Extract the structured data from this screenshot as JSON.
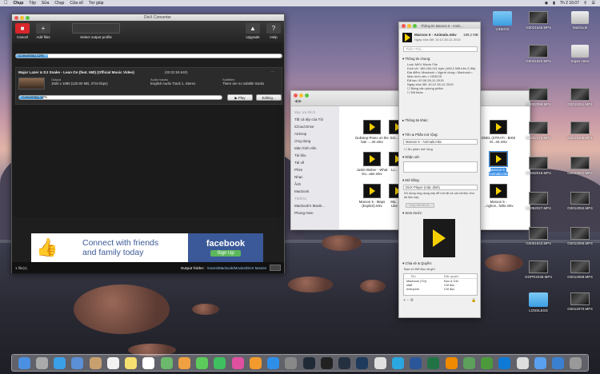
{
  "menubar": {
    "apple": "",
    "app": "Chụp",
    "items": [
      "Tệp",
      "Sửa",
      "Chụp",
      "Cửa sổ",
      "Trợ giúp"
    ],
    "status": "Th 2 16:07"
  },
  "divx": {
    "window_title": "DivX Converter",
    "cancel_label": "Cancel",
    "add_files_label": "Add files",
    "select_profile_label": "Select output profile",
    "upgrade_label": "Upgrade",
    "help_label": "Help",
    "overall_status": "Converting 12%",
    "overall_progress": 0.12,
    "job_title": "Major Lazer & DJ Snake - Lean On (feat. MØ) (Official Music Video)",
    "job_duration": "(00:02:58.840)",
    "output_label": "Output",
    "output_detail": "1920 x 1080 (120.00 MB, 3734 kbps)",
    "audio_label": "Audio tracks",
    "audio_detail": "English Audio Track 1, Stereo",
    "subtitle_label": "Subtitles",
    "subtitle_detail": "There are no subtitle tracks",
    "job_status": "Converting 12%",
    "job_progress": 0.12,
    "play_label": "Play",
    "editing_label": "Editing...",
    "ad_text_line1": "Connect with friends",
    "ad_text_line2": "and family today",
    "ad_brand": "facebook",
    "ad_cta": "Sign Up",
    "file_count": "1 file(s)",
    "output_folder_label": "Output folder:",
    "output_folder_path": "/Users/Macbook/Movies/DivX Movies"
  },
  "finder": {
    "sidebar_heading": "Mục ưa thích",
    "sidebar_items": [
      "Tất cả tệp của Tôi",
      "iCloud Drive",
      "AirDrop",
      "Ứng dụng",
      "Màn hình nền",
      "Tài liệu",
      "Tải về",
      "Phim",
      "Nhạc",
      "Ảnh",
      "Macbook"
    ],
    "devices_heading": "Thiết bị",
    "device_items": [
      "Macbook's MacB...",
      "Phong Hien"
    ],
    "files": [
      {
        "name": "Dubstep-Piano on the late -...4K.mkv"
      },
      {
        "name": "Em..."
      },
      {
        "name": "Justin Bieber - What Do...ater.mkv"
      },
      {
        "name": "Lo..."
      },
      {
        "name": "Maroon 5 - Maps (Explicit).mkv"
      },
      {
        "name": "Ma... Like"
      },
      {
        "name": "ONEL (STRATI - BIKE M...4K.mkv"
      },
      {
        "name": "Maroon 5 - Animals.mkv"
      },
      {
        "name": "Maroon 5 - ...nghon...hslts.mkv"
      }
    ]
  },
  "info": {
    "window_title": "Thông tin Maroon 5 - Anim...",
    "file_name": "Maroon 5 - Animals.mkv",
    "file_size": "189,2 MB",
    "modified": "Ngày sửa đổi: 10:12 28-12-2015",
    "tags_placeholder": "Thêm Thẻ...",
    "general_heading": "Thông tin chung:",
    "general_rows": [
      "Loại: MKV Movie File",
      "Kích cỡ: 189.184.011 byte (189,2 MB trên ổ đĩa)",
      "Địa điểm: Macbook • Người dùng • Macbook • Màn hình nền • VIDEOS",
      "Đã tạo: 02:08 28-12-2015",
      "Ngày sửa đổi: 10:12 28-12-2015",
      "Bảng văn phòng phẩm",
      "Đã khóa"
    ],
    "more_heading": "Thông tin khác:",
    "name_heading": "Tên & Phần mở rộng:",
    "name_value": "Maroon 5 - Animals.mkv",
    "hide_ext": "Ẩn phần mở rộng",
    "comments_heading": "Nhận xét:",
    "open_with_heading": "Mở bằng:",
    "open_with_app": "DivX Player (mặc định)",
    "open_with_note": "Sử dụng ứng dụng này để mở tất cả các tài liệu như tài liệu này.",
    "change_all": "Thay đổi tất cả...",
    "preview_heading": "Xem trước:",
    "sharing_heading": "Chia sẻ & Quyền:",
    "sharing_note": "Bạn có thể đọc và ghi",
    "perm_name_header": "Tên",
    "perm_priv_header": "Đặc quyền",
    "perms": [
      {
        "name": "Macbook (Tôi)",
        "priv": "Đọc & Ghi"
      },
      {
        "name": "staff",
        "priv": "Chỉ đọc"
      },
      {
        "name": "everyone",
        "priv": "Chỉ đọc"
      }
    ]
  },
  "desktop": {
    "icons": [
      {
        "label": "VIDEOS",
        "kind": "folder"
      },
      {
        "label": "G0021646.MP4",
        "kind": "thumb"
      },
      {
        "label": "Macbook",
        "kind": "drive"
      },
      {
        "label": "G0021622.MP4",
        "kind": "thumb"
      },
      {
        "label": "Super Here",
        "kind": "drive"
      },
      {
        "label": "G0032098.MP4",
        "kind": "thumb"
      },
      {
        "label": "G0011051.MP4",
        "kind": "thumb"
      },
      {
        "label": "G0032175.MP4",
        "kind": "thumb"
      },
      {
        "label": "G0011006.MP4",
        "kind": "thumb"
      },
      {
        "label": "G0042018.MP4",
        "kind": "thumb"
      },
      {
        "label": "G0012001.MP4",
        "kind": "thumb"
      },
      {
        "label": "G0052027.MP4",
        "kind": "thumb"
      },
      {
        "label": "G0012052.MP4",
        "kind": "thumb"
      },
      {
        "label": "G0061943.MP4",
        "kind": "thumb"
      },
      {
        "label": "G0012056.MP4",
        "kind": "thumb"
      },
      {
        "label": "GOPR2048.MP4",
        "kind": "thumb"
      },
      {
        "label": "G0012069.MP4",
        "kind": "thumb"
      },
      {
        "label": "LOSSLESS",
        "kind": "folder"
      },
      {
        "label": "G0012070.MP4",
        "kind": "thumb"
      }
    ]
  },
  "dock": {
    "apps": [
      "finder",
      "launchpad",
      "safari",
      "mail",
      "contacts",
      "calendar",
      "notes",
      "reminders",
      "maps",
      "photos",
      "messages",
      "facetime",
      "itunes",
      "ibooks",
      "app-store",
      "system-preferences",
      "divx",
      "terminal",
      "lightroom",
      "photoshop",
      "chrome",
      "skype",
      "word",
      "excel",
      "vlc",
      "torrent",
      "utorrent",
      "teamviewer",
      "preview",
      "finder-2",
      "downloads",
      "trash"
    ]
  }
}
